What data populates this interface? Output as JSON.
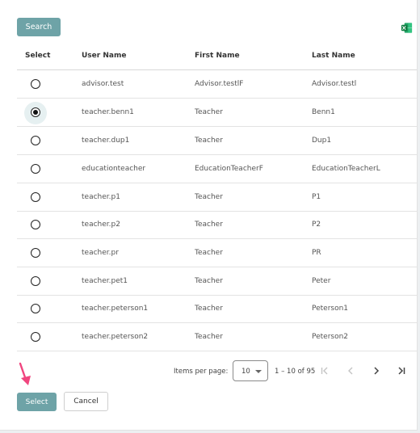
{
  "toolbar": {
    "search_label": "Search",
    "export_icon": "excel-icon",
    "brand_color": "#6ea3a7"
  },
  "table": {
    "headers": [
      "Select",
      "User Name",
      "First Name",
      "Last Name"
    ],
    "rows": [
      {
        "user_name": "advisor.test",
        "first_name": "Advisor.testlF",
        "last_name": "Advisor.testl",
        "selected": false
      },
      {
        "user_name": "teacher.benn1",
        "first_name": "Teacher",
        "last_name": "Benn1",
        "selected": true
      },
      {
        "user_name": "teacher.dup1",
        "first_name": "Teacher",
        "last_name": "Dup1",
        "selected": false
      },
      {
        "user_name": "educationteacher",
        "first_name": "EducationTeacherF",
        "last_name": "EducationTeacherL",
        "selected": false
      },
      {
        "user_name": "teacher.p1",
        "first_name": "Teacher",
        "last_name": "P1",
        "selected": false
      },
      {
        "user_name": "teacher.p2",
        "first_name": "Teacher",
        "last_name": "P2",
        "selected": false
      },
      {
        "user_name": "teacher.pr",
        "first_name": "Teacher",
        "last_name": "PR",
        "selected": false
      },
      {
        "user_name": "teacher.pet1",
        "first_name": "Teacher",
        "last_name": "Peter",
        "selected": false
      },
      {
        "user_name": "teacher.peterson1",
        "first_name": "Teacher",
        "last_name": "Peterson1",
        "selected": false
      },
      {
        "user_name": "teacher.peterson2",
        "first_name": "Teacher",
        "last_name": "Peterson2",
        "selected": false
      }
    ]
  },
  "paginator": {
    "items_per_page_label": "Items per page:",
    "page_size": "10",
    "range_label": "1 – 10 of 95",
    "buttons": [
      "first-page-icon",
      "previous-page-icon",
      "next-page-icon",
      "last-page-icon"
    ]
  },
  "actions": {
    "select_label": "Select",
    "cancel_label": "Cancel"
  },
  "annotation": {
    "icon": "pink-arrow-icon",
    "color": "#f0457f"
  }
}
